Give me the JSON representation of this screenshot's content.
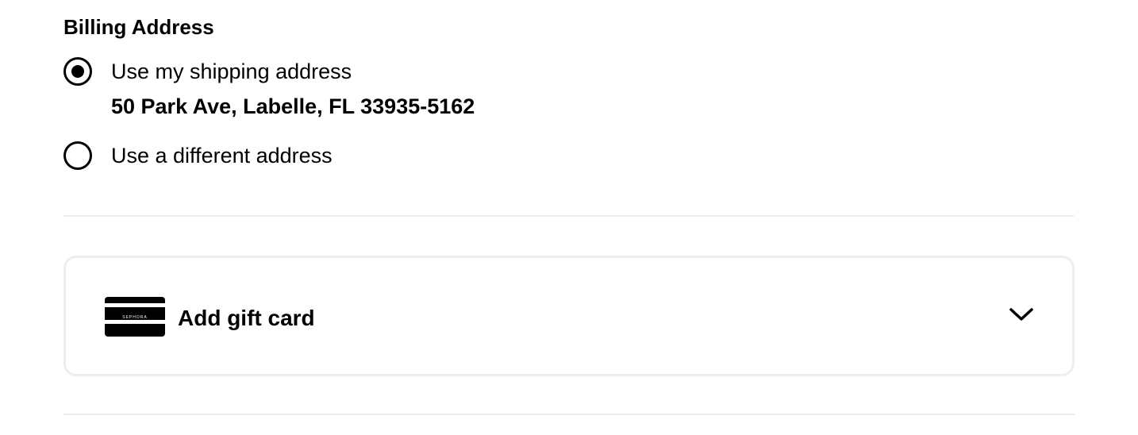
{
  "billing": {
    "title": "Billing Address",
    "options": [
      {
        "label": "Use my shipping address",
        "selected": true
      },
      {
        "label": "Use a different address",
        "selected": false
      }
    ],
    "shipping_address": "50 Park Ave, Labelle, FL 33935-5162"
  },
  "gift_card": {
    "label": "Add gift card",
    "logo_text": "SEPHORA",
    "icon": "chevron-down-icon"
  },
  "colors": {
    "text": "#000000",
    "divider": "#eeeeee",
    "card_border": "#eeeeee",
    "background": "#ffffff"
  }
}
